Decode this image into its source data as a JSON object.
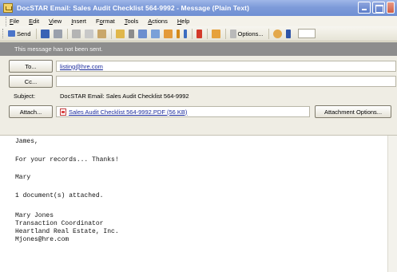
{
  "window": {
    "title": "DocSTAR Email:  Sales Audit Checklist 564-9992 - Message (Plain Text)"
  },
  "menu": [
    {
      "pre": "",
      "u": "F",
      "post": "ile"
    },
    {
      "pre": "",
      "u": "E",
      "post": "dit"
    },
    {
      "pre": "",
      "u": "V",
      "post": "iew"
    },
    {
      "pre": "",
      "u": "I",
      "post": "nsert"
    },
    {
      "pre": "F",
      "u": "o",
      "post": "rmat"
    },
    {
      "pre": "",
      "u": "T",
      "post": "ools"
    },
    {
      "pre": "",
      "u": "A",
      "post": "ctions"
    },
    {
      "pre": "",
      "u": "H",
      "post": "elp"
    }
  ],
  "toolbar": {
    "send_label": "Send",
    "options_label": "Options...",
    "icon_colors": {
      "send": "#4a74c9",
      "save": "#3a62b5",
      "attach": "#8c8c8c",
      "flag": "#d33a2a",
      "importance": "#d48a1a"
    }
  },
  "infobar": {
    "text": "This message has not been sent."
  },
  "header": {
    "to_button": "To...",
    "to_value": "listing@hre.com",
    "cc_button": "Cc...",
    "cc_value": "",
    "subject_label": "Subject:",
    "subject_value": "DocSTAR Email:  Sales Audit Checklist 564-9992",
    "attach_button": "Attach...",
    "attachment_name": "Sales Audit Checklist 564-9992.PDF (56 KB)",
    "attachment_options_button": "Attachment Options..."
  },
  "body": {
    "lines": [
      "James,",
      "For your records... Thanks!",
      "Mary",
      "1 document(s) attached.",
      "Mary Jones",
      "Transaction Coordinator",
      "Heartland Real Estate, Inc.",
      "Mjones@hre.com"
    ]
  }
}
